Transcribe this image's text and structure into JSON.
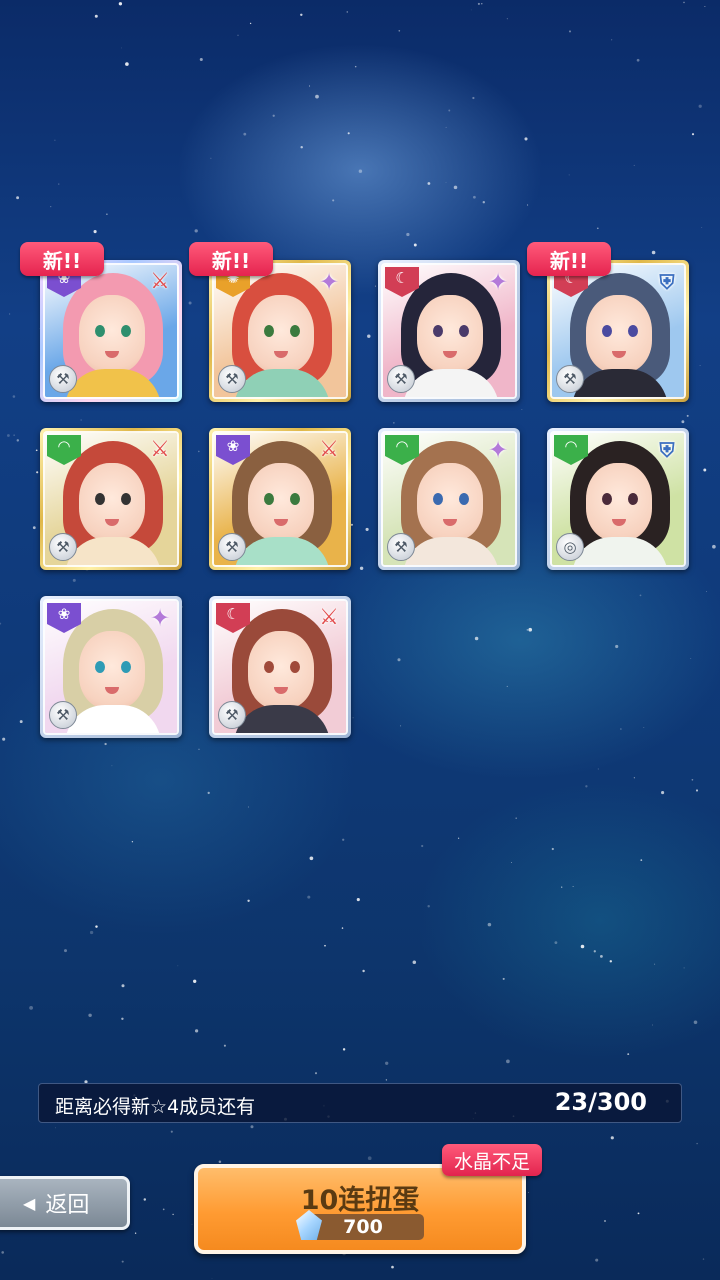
{
  "cards": [
    {
      "attr": "cute",
      "attr_icon": "❀",
      "skill": "sword",
      "skill_icon": "⚔",
      "type_icon": "⚒",
      "is_new": true,
      "rarity": "ssr",
      "hair": "#f39ab0",
      "eyes": "#2e8f6e",
      "bg": "#6aa7e8",
      "outfit": "#f1c24a"
    },
    {
      "attr": "passion",
      "attr_icon": "✺",
      "skill": "star",
      "skill_icon": "✦",
      "type_icon": "⚒",
      "is_new": true,
      "rarity": "sr",
      "hair": "#d84f3f",
      "eyes": "#3b7a3e",
      "bg": "#f2c59b",
      "outfit": "#8fd0b6"
    },
    {
      "attr": "cool",
      "attr_icon": "☾",
      "skill": "star",
      "skill_icon": "✦",
      "type_icon": "⚒",
      "is_new": false,
      "rarity": "r",
      "hair": "#25253a",
      "eyes": "#4a3a6a",
      "bg": "#f0b6c9",
      "outfit": "#f4f4f4"
    },
    {
      "attr": "cool",
      "attr_icon": "☾",
      "skill": "shield",
      "skill_icon": "⛨",
      "type_icon": "⚒",
      "is_new": true,
      "rarity": "sr",
      "hair": "#4a5a7a",
      "eyes": "#4a4aa0",
      "bg": "#9ec8ef",
      "outfit": "#2a2a36"
    },
    {
      "attr": "green",
      "attr_icon": "◠",
      "skill": "sword",
      "skill_icon": "⚔",
      "type_icon": "⚒",
      "is_new": false,
      "rarity": "sr",
      "hair": "#c5493a",
      "eyes": "#333333",
      "bg": "#e5d59a",
      "outfit": "#f6e4c8"
    },
    {
      "attr": "cute",
      "attr_icon": "❀",
      "skill": "sword",
      "skill_icon": "⚔",
      "type_icon": "⚒",
      "is_new": false,
      "rarity": "sr",
      "hair": "#8a6040",
      "eyes": "#3b7a3e",
      "bg": "#e9b34a",
      "outfit": "#a8e0c8"
    },
    {
      "attr": "green",
      "attr_icon": "◠",
      "skill": "star",
      "skill_icon": "✦",
      "type_icon": "⚒",
      "is_new": false,
      "rarity": "r",
      "hair": "#a4724f",
      "eyes": "#3a6ab0",
      "bg": "#d6e4b8",
      "outfit": "#f3e7dc"
    },
    {
      "attr": "green",
      "attr_icon": "◠",
      "skill": "shield",
      "skill_icon": "⛨",
      "type_icon": "◎",
      "is_new": false,
      "rarity": "r",
      "hair": "#2a2222",
      "eyes": "#4a2a3a",
      "bg": "#cfe2a4",
      "outfit": "#f0f4ee"
    },
    {
      "attr": "cute",
      "attr_icon": "❀",
      "skill": "star",
      "skill_icon": "✦",
      "type_icon": "⚒",
      "is_new": false,
      "rarity": "r",
      "hair": "#d8cfa6",
      "eyes": "#2e9bb5",
      "bg": "#f1d8ef",
      "outfit": "#ffffff"
    },
    {
      "attr": "cool",
      "attr_icon": "☾",
      "skill": "sword",
      "skill_icon": "⚔",
      "type_icon": "⚒",
      "is_new": false,
      "rarity": "r",
      "hair": "#9a4a3a",
      "eyes": "#a04a3a",
      "bg": "#f2ccd6",
      "outfit": "#3a3a48"
    }
  ],
  "new_badge_label": "新!!",
  "progress": {
    "label": "距离必得新☆4成员还有",
    "count": "23/300"
  },
  "back_button": {
    "arrow": "◀",
    "label": "返回"
  },
  "gacha_button": {
    "title": "10连扭蛋",
    "cost": "700"
  },
  "insufficient_label": "水晶不足"
}
